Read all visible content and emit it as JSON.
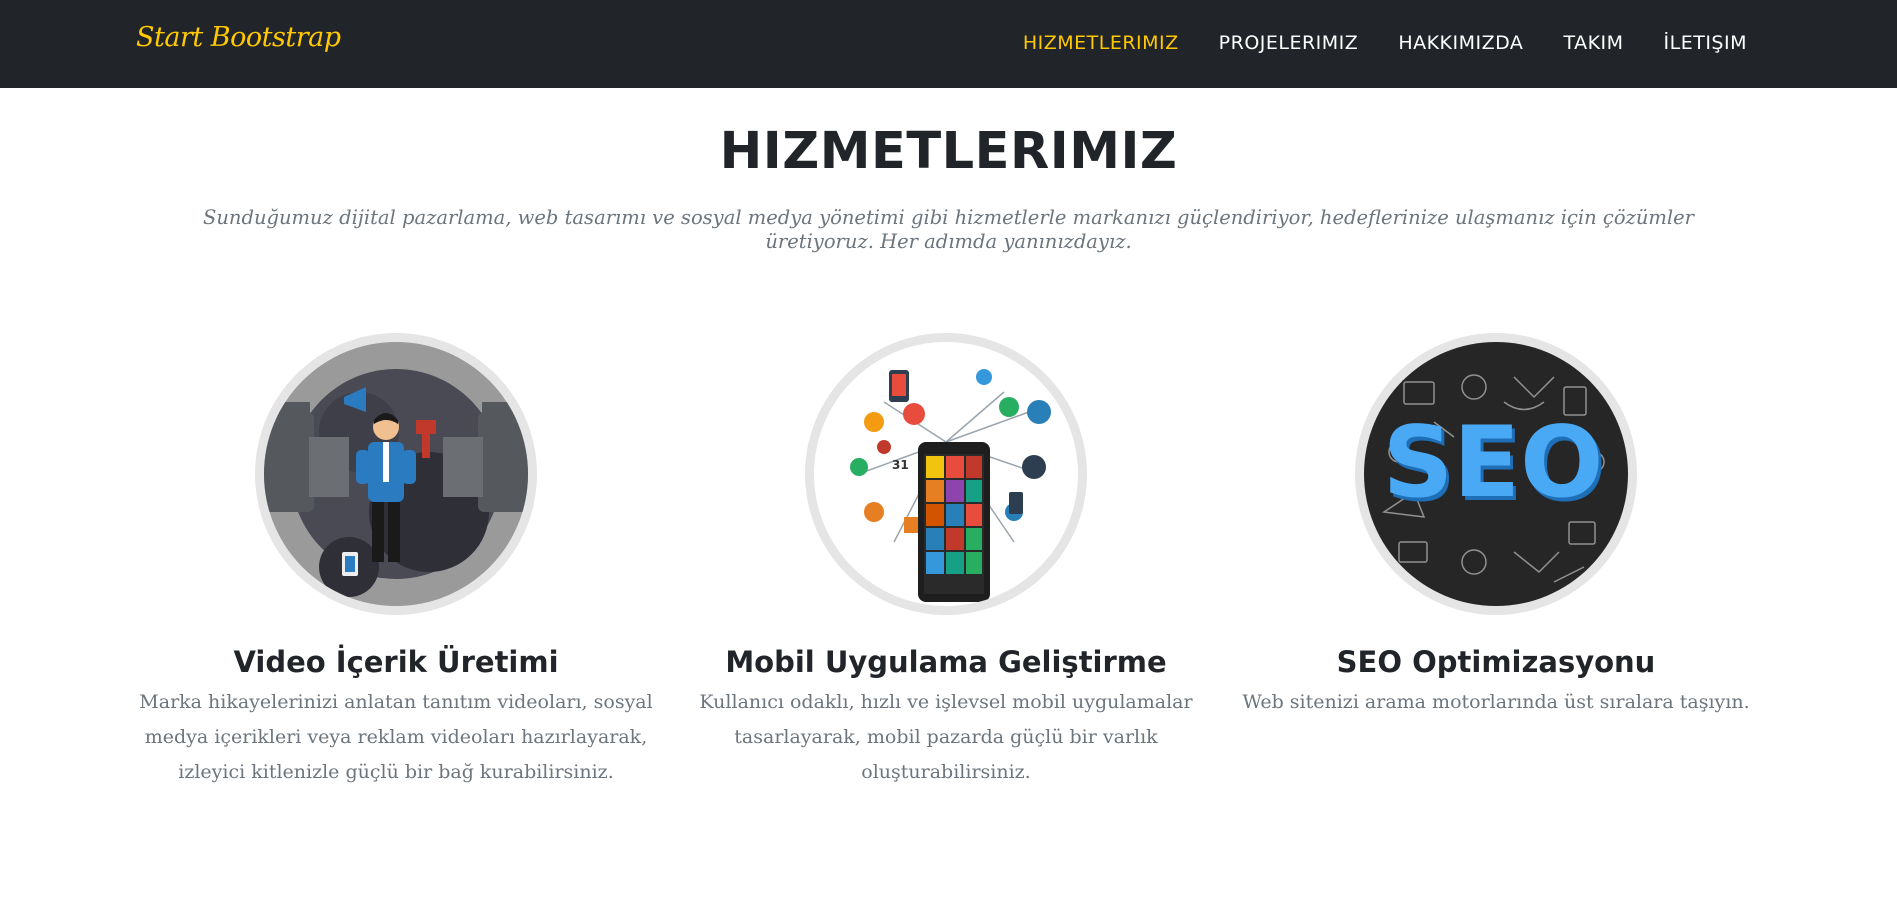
{
  "navbar": {
    "brand": "Start Bootstrap",
    "links": [
      "HIZMETLERIMIZ",
      "PROJELERIMIZ",
      "HAKKIMIZDA",
      "TAKIM",
      "İLETIŞIM"
    ],
    "active_index": 0,
    "accent_color": "#ffc800",
    "background_color": "#212529"
  },
  "services": {
    "heading": "HIZMETLERIMIZ",
    "subheading": "Sunduğumuz dijital pazarlama, web tasarımı ve sosyal medya yönetimi gibi hizmetlerle markanızı güçlendiriyor, hedeflerinize ulaşmanız için çözümler üretiyoruz. Her adımda yanınızdayız.",
    "items": [
      {
        "title": "Video İçerik Üretimi",
        "text": "Marka hikayelerinizi anlatan tanıtım videoları, sosyal medya içerikleri veya reklam videoları hazırlayarak, izleyici kitlenizle güçlü bir bağ kurabilirsiniz.",
        "image": "video-production-illustration"
      },
      {
        "title": "Mobil Uygulama Geliştirme",
        "text": "Kullanıcı odaklı, hızlı ve işlevsel mobil uygulamalar tasarlayarak, mobil pazarda güçlü bir varlık oluşturabilirsiniz.",
        "image": "mobile-app-illustration",
        "calendar_label": "31"
      },
      {
        "title": "SEO Optimizasyonu",
        "text": "Web sitenizi arama motorlarında üst sıralara taşıyın.",
        "image": "seo-illustration",
        "image_text": "SEO"
      }
    ]
  }
}
